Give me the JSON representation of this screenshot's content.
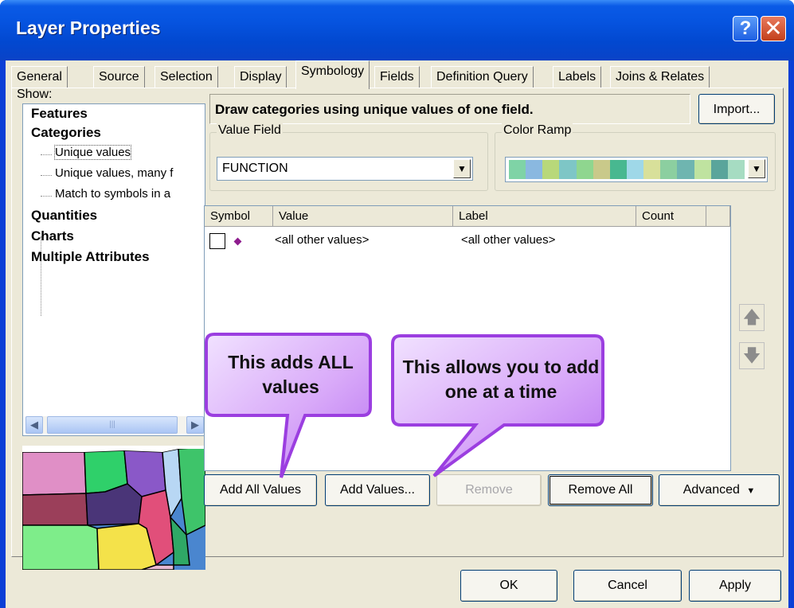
{
  "window": {
    "title": "Layer Properties",
    "help_glyph": "?",
    "close_glyph": "✕"
  },
  "tabs": [
    "General",
    "Source",
    "Selection",
    "Display",
    "Symbology",
    "Fields",
    "Definition Query",
    "Labels",
    "Joins & Relates"
  ],
  "active_tab": "Symbology",
  "show": {
    "label": "Show:",
    "items": [
      {
        "label": "Features",
        "level": 0
      },
      {
        "label": "Categories",
        "level": 0
      },
      {
        "label": "Unique values",
        "level": 1,
        "selected": true
      },
      {
        "label": "Unique values, many f",
        "level": 1
      },
      {
        "label": "Match to symbols in a",
        "level": 1
      },
      {
        "label": "Quantities",
        "level": 0
      },
      {
        "label": "Charts",
        "level": 0
      },
      {
        "label": "Multiple Attributes",
        "level": 0
      }
    ]
  },
  "description": "Draw categories using unique values of one field.",
  "import_label": "Import...",
  "value_field": {
    "title": "Value Field",
    "value": "FUNCTION"
  },
  "color_ramp": {
    "title": "Color Ramp",
    "colors": [
      "#7fd3a6",
      "#8ab8e0",
      "#b8d87a",
      "#7ec6c6",
      "#8fd68f",
      "#c9c98a",
      "#48b890",
      "#9fd8e8",
      "#d8e09a",
      "#8ccfa0",
      "#6fb5b0",
      "#bfe3a0",
      "#5aa59b",
      "#a6dcc2"
    ]
  },
  "grid": {
    "columns": [
      "Symbol",
      "Value",
      "Label",
      "Count"
    ],
    "rows": [
      {
        "value": "<all other values>",
        "label": "<all other values>",
        "symbol_color": "#8e1c8e"
      }
    ]
  },
  "buttons": {
    "add_all": "Add All Values",
    "add_values": "Add Values...",
    "remove": "Remove",
    "remove_all": "Remove All",
    "advanced": "Advanced",
    "ok": "OK",
    "cancel": "Cancel",
    "apply": "Apply"
  },
  "callouts": {
    "left": "This adds ALL values",
    "right": "This allows you to add one at a time"
  },
  "colors": {
    "title_bar": "#0a5ae6",
    "dialog_bg": "#ece9d8",
    "callout_fill": "#d6a8f8",
    "callout_border": "#9b3ee0"
  }
}
